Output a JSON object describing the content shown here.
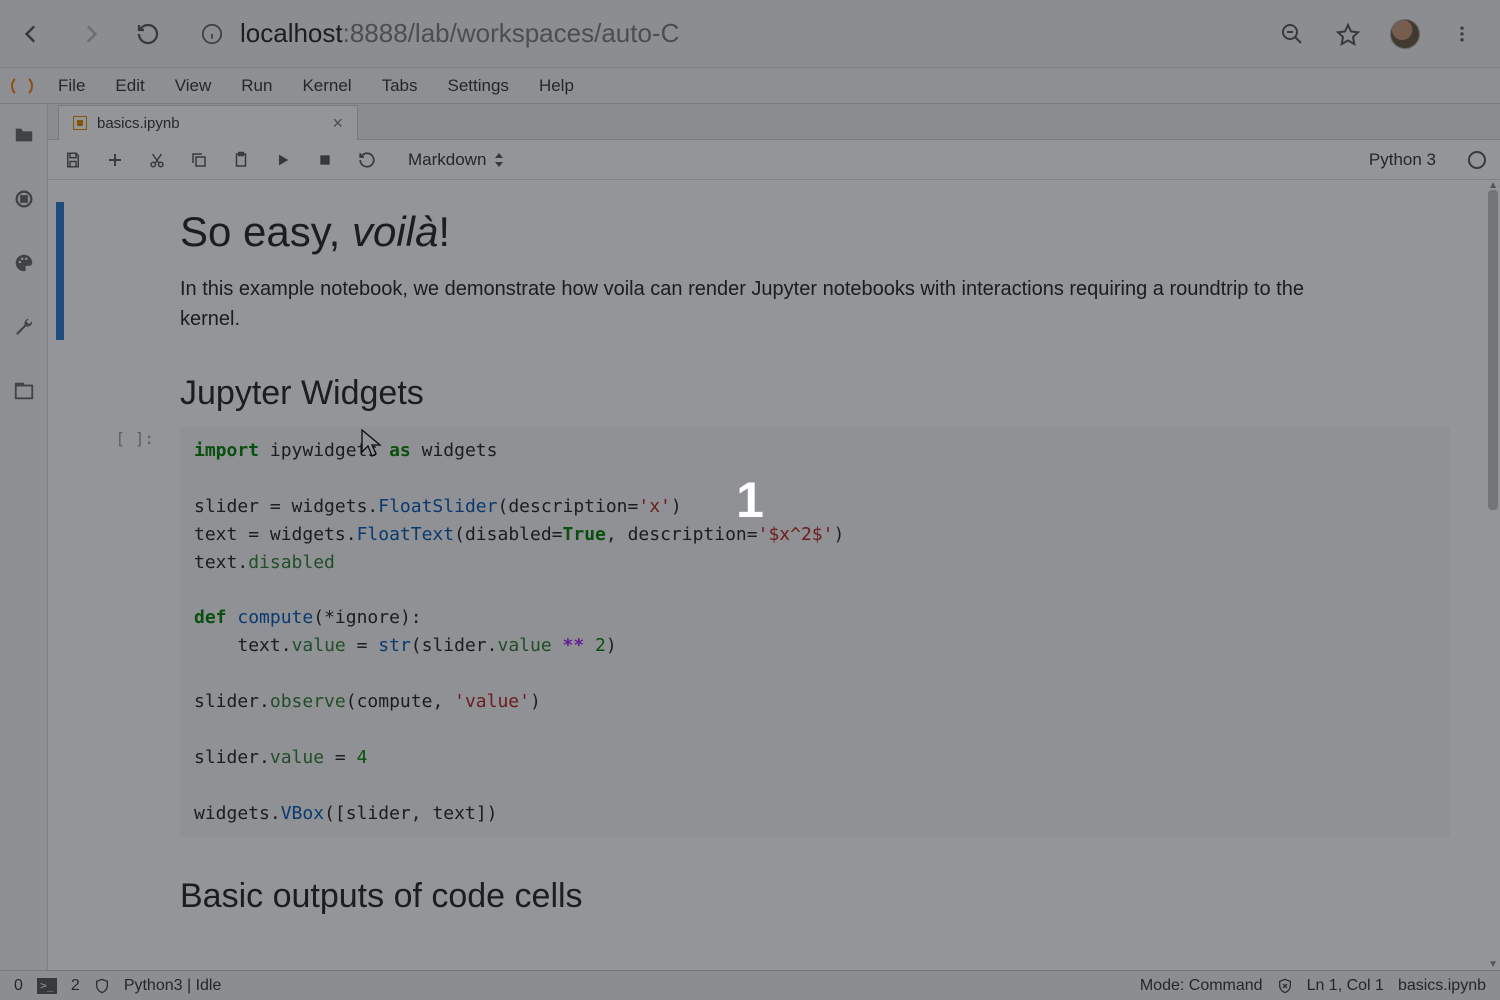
{
  "browser": {
    "url_host": "localhost",
    "url_rest": ":8888/lab/workspaces/auto-C"
  },
  "menu": [
    "File",
    "Edit",
    "View",
    "Run",
    "Kernel",
    "Tabs",
    "Settings",
    "Help"
  ],
  "tab": {
    "label": "basics.ipynb"
  },
  "toolbar": {
    "cell_type": "Markdown",
    "kernel": "Python 3"
  },
  "cells": {
    "md1_h1_a": "So easy, ",
    "md1_h1_em": "voilà",
    "md1_h1_b": "!",
    "md1_p": "In this example notebook, we demonstrate how voila can render Jupyter notebooks with interactions requiring a roundtrip to the kernel.",
    "md2_h2": "Jupyter Widgets",
    "code_prompt": "[ ]:",
    "md3_h2": "Basic outputs of code cells"
  },
  "code_tokens": {
    "import": "import",
    "ipw": "ipywidgets",
    "as": "as",
    "widgets": "widgets",
    "slider": "slider",
    "eq": " = ",
    "dot": ".",
    "FloatSlider": "FloatSlider",
    "lp": "(",
    "rp": ")",
    "desc": "description",
    "eqs": "=",
    "sx": "'x'",
    "text": "text",
    "FloatText": "FloatText",
    "disabled": "disabled",
    "True": "True",
    "comma": ", ",
    "sxx": "'$x^2$'",
    "text_disabled_line": "text.",
    "disabled2": "disabled",
    "def": "def",
    "compute": "compute",
    "star": "*",
    "ignore": "ignore",
    "colon": "):",
    "indent": "    ",
    "value": "value",
    "str": "str",
    "dstar": " ** ",
    "two": "2",
    "observe": "observe",
    "sval": "'value'",
    "four": "4",
    "VBox": "VBox",
    "lb": "[",
    "rb": "]",
    "sl": "slider",
    "tx": "text"
  },
  "status": {
    "left_num": "0",
    "count": "2",
    "kernel": "Python3 | Idle",
    "mode": "Mode: Command",
    "pos": "Ln 1, Col 1",
    "file": "basics.ipynb"
  },
  "overlay_number": "1"
}
